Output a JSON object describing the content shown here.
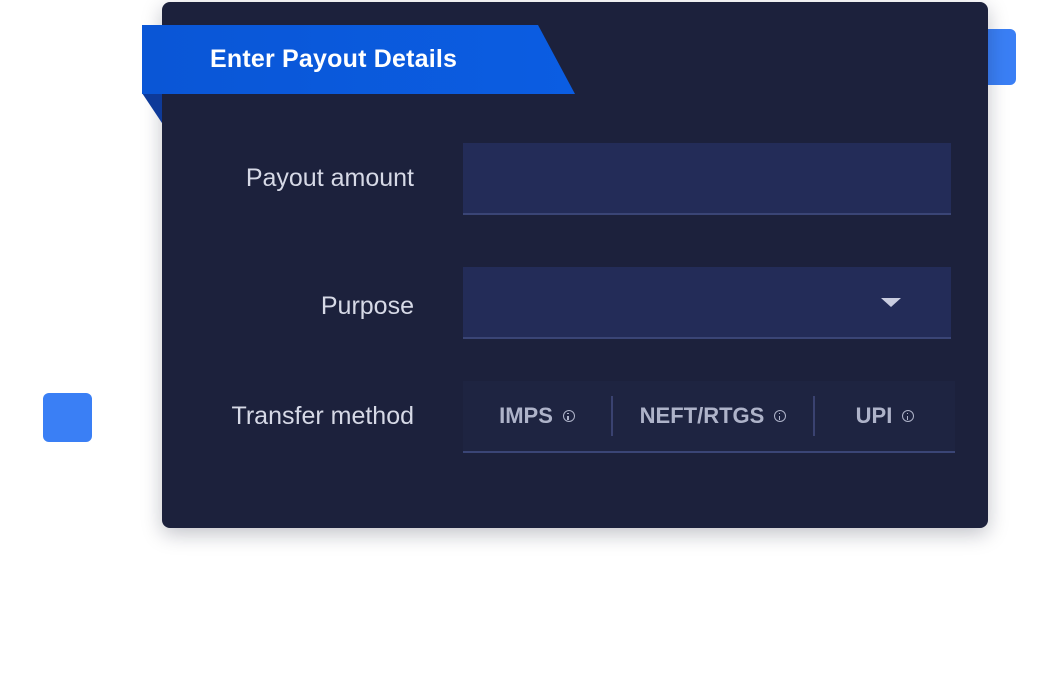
{
  "form": {
    "title": "Enter Payout Details",
    "fields": {
      "amount_label": "Payout amount",
      "amount_value": "",
      "purpose_label": "Purpose",
      "purpose_value": "",
      "transfer_label": "Transfer method"
    },
    "transfer_methods": [
      {
        "label": "IMPS",
        "icon": "info-icon"
      },
      {
        "label": "NEFT/RTGS",
        "icon": "info-icon"
      },
      {
        "label": "UPI",
        "icon": "info-icon"
      }
    ]
  },
  "colors": {
    "card_bg": "#1c213c",
    "ribbon": "#0b5de2",
    "input_bg": "#232c58",
    "accent_square": "#3a7ff5"
  }
}
